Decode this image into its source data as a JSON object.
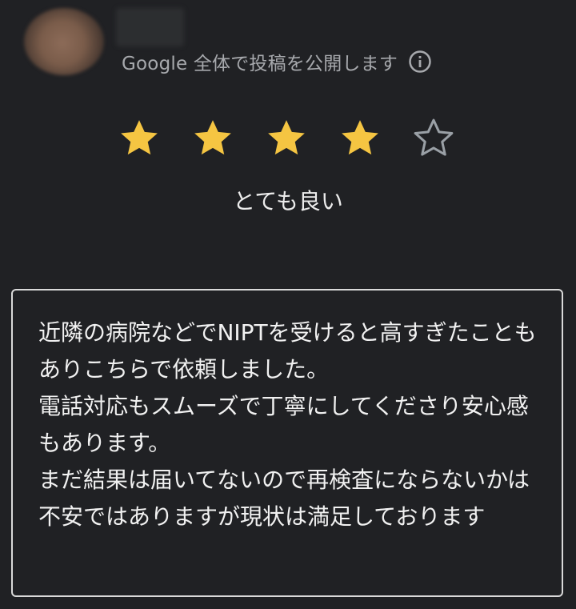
{
  "header": {
    "public_notice": "Google 全体で投稿を公開します",
    "info_icon": "info-icon"
  },
  "rating": {
    "value": 4,
    "max": 5,
    "label": "とても良い",
    "filled_color": "#f5c542",
    "empty_color": "#9aa0a6"
  },
  "review": {
    "text": "近隣の病院などでNIPTを受けると高すぎたこともありこちらで依頼しました。\n電話対応もスムーズで丁寧にしてくださり安心感もあります。\nまだ結果は届いてないので再検査にならないかは不安ではありますが現状は満足しております"
  },
  "colors": {
    "background": "#202124",
    "border": "#d9d9d9",
    "text": "#f1f1f1",
    "muted_text": "#a7a9ad"
  }
}
